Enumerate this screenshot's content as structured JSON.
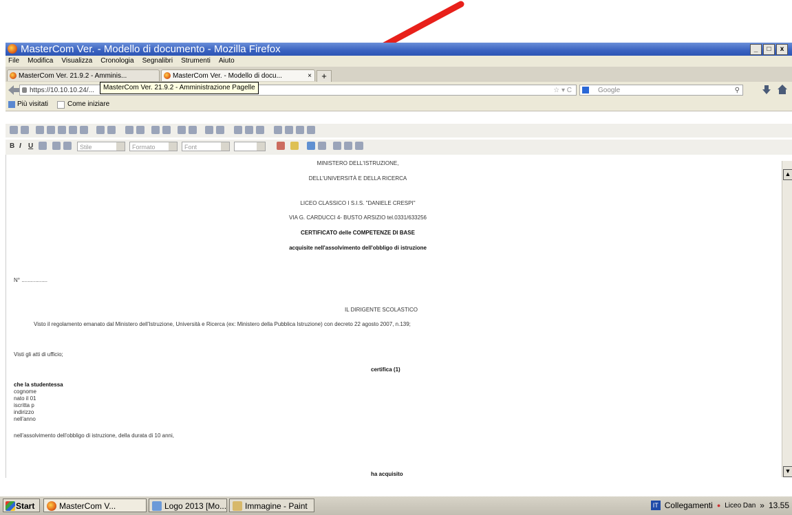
{
  "window": {
    "title": "MasterCom Ver. - Modello di documento - Mozilla Firefox",
    "min": "_",
    "max": "□",
    "close": "x"
  },
  "menu": [
    "File",
    "Modifica",
    "Visualizza",
    "Cronologia",
    "Segnalibri",
    "Strumenti",
    "Aiuto"
  ],
  "tabs": {
    "tab1": "MasterCom Ver. 21.9.2 - Amminis...",
    "tab2": "MasterCom Ver. - Modello di docu...",
    "close": "×",
    "new_tab": "+",
    "tooltip": "MasterCom Ver. 21.9.2 - Amministrazione Pagelle"
  },
  "nav": {
    "url": "https://10.10.10.24/...",
    "search_placeholder": "Google"
  },
  "bookmarks": [
    "Più visitati",
    "Come iniziare"
  ],
  "editor": {
    "bold": "B",
    "italic": "I",
    "underline": "U",
    "style_combo": "Stile",
    "format_combo": "Formato",
    "font_combo": "Font"
  },
  "document": {
    "lines": {
      "l1": "MINISTERO DELL'ISTRUZIONE,",
      "l2": "DELL'UNIVERSITÀ E DELLA RICERCA",
      "l3": "LICEO CLASSICO I S.I.S. \"DANIELE CRESPI\"",
      "l4": "VIA G. CARDUCCI 4- BUSTO ARSIZIO tel.0331/633256",
      "l5": "CERTIFICATO delle COMPETENZE DI BASE",
      "l6": "acquisite nell'assolvimento dell'obbligo di istruzione",
      "l7": "N° .................",
      "l8": "IL DIRIGENTE SCOLASTICO",
      "l9": "Visto il regolamento emanato dal Ministero dell'Istruzione, Università e Ricerca (ex: Ministero della Pubblica Istruzione) con decreto 22 agosto 2007, n.139;",
      "l10": "Visti gli atti di ufficio;",
      "l11": "certifica (1)",
      "l12": "che la studentessa",
      "l13": "cognome",
      "l14": "nato il 01",
      "l15": "iscritta p",
      "l16": "indirizzo",
      "l17": "nell'anno",
      "l18": "nell'assolvimento dell'obbligo di istruzione, della durata di 10 anni,",
      "l19": "ha acquisito"
    }
  },
  "taskbar": {
    "start": "Start",
    "t1": "MasterCom V...",
    "t2": "Logo 2013 [Mo...",
    "t3": "Immagine - Paint",
    "tray_links": "Collegamenti",
    "tray_user": "Liceo Dan",
    "clock": "13.55"
  },
  "colors": {
    "arrow": "#e8201a",
    "titlebar": "#3a62c0"
  }
}
